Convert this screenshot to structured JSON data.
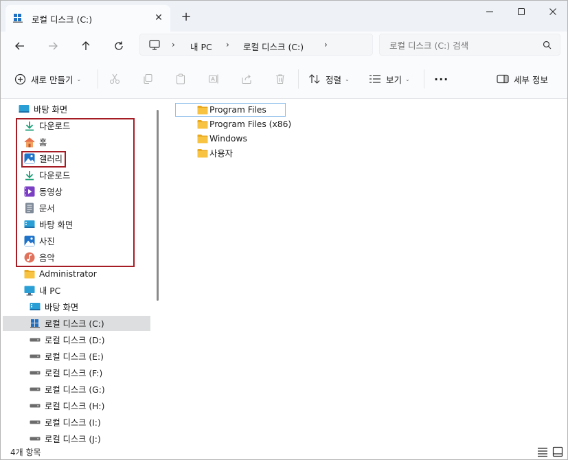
{
  "window": {
    "tab_title": "로컬 디스크 (C:)",
    "close_tab_glyph": "✕",
    "new_tab_glyph": "+"
  },
  "address": {
    "items": [
      "내 PC",
      "로컬 디스크 (C:)"
    ]
  },
  "search": {
    "placeholder": "로컬 디스크 (C:) 검색"
  },
  "toolbar": {
    "new_label": "새로 만들기",
    "sort_label": "정렬",
    "view_label": "보기",
    "more_label": "···",
    "details_label": "세부 정보"
  },
  "sidebar": {
    "items": [
      {
        "label": "바탕 화면",
        "icon": "desktop-icon"
      },
      {
        "label": "다운로드",
        "icon": "download-icon"
      },
      {
        "label": "홈",
        "icon": "home-icon"
      },
      {
        "label": "갤러리",
        "icon": "gallery-icon"
      },
      {
        "label": "다운로드",
        "icon": "download-icon"
      },
      {
        "label": "동영상",
        "icon": "video-icon"
      },
      {
        "label": "문서",
        "icon": "document-icon"
      },
      {
        "label": "바탕 화면",
        "icon": "desktop-icon"
      },
      {
        "label": "사진",
        "icon": "pictures-icon"
      },
      {
        "label": "음악",
        "icon": "music-icon"
      },
      {
        "label": "Administrator",
        "icon": "folder-icon"
      },
      {
        "label": "내 PC",
        "icon": "pc-icon"
      },
      {
        "label": "바탕 화면",
        "icon": "desktop-icon"
      },
      {
        "label": "로컬 디스크 (C:)",
        "icon": "windows-drive-icon",
        "selected": true
      },
      {
        "label": "로컬 디스크 (D:)",
        "icon": "drive-icon"
      },
      {
        "label": "로컬 디스크 (E:)",
        "icon": "drive-icon"
      },
      {
        "label": "로컬 디스크 (F:)",
        "icon": "drive-icon"
      },
      {
        "label": "로컬 디스크 (G:)",
        "icon": "drive-icon"
      },
      {
        "label": "로컬 디스크 (H:)",
        "icon": "drive-icon"
      },
      {
        "label": "로컬 디스크 (I:)",
        "icon": "drive-icon"
      },
      {
        "label": "로컬 디스크 (J:)",
        "icon": "drive-icon"
      }
    ]
  },
  "files": [
    {
      "name": "Program Files",
      "icon": "folder-icon"
    },
    {
      "name": "Program Files (x86)",
      "icon": "folder-icon"
    },
    {
      "name": "Windows",
      "icon": "folder-icon"
    },
    {
      "name": "사용자",
      "icon": "folder-icon"
    }
  ],
  "status": {
    "item_count": "4개 항목"
  },
  "colors": {
    "accent": "#0067c0",
    "folder": "#f7c341",
    "highlight_box": "#a61c24",
    "selected_bg": "#dddee0"
  }
}
